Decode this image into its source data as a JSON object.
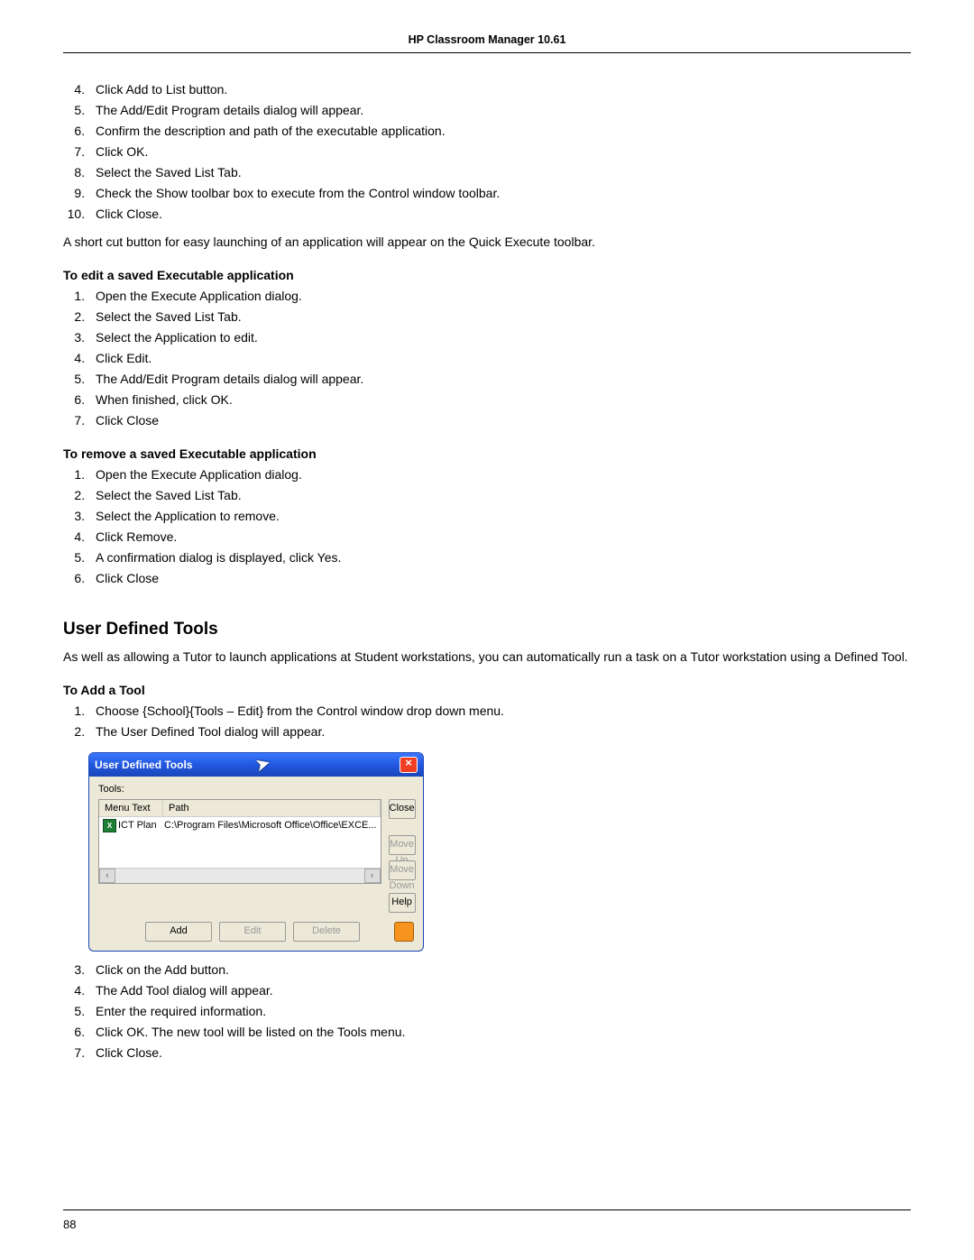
{
  "header": "HP Classroom Manager 10.61",
  "list1_start": 4,
  "list1": [
    "Click Add to List button.",
    "The Add/Edit Program details dialog will appear.",
    "Confirm the description and path of the executable application.",
    "Click OK.",
    "Select the Saved List Tab.",
    "Check the Show toolbar box to execute from the Control window toolbar.",
    "Click Close."
  ],
  "para_after_list1": "A short cut button for easy launching of an application will appear on the Quick Execute toolbar.",
  "heading_edit": "To edit a saved Executable application",
  "list_edit": [
    "Open the Execute Application dialog.",
    "Select the Saved List Tab.",
    "Select the Application to edit.",
    "Click Edit.",
    "The Add/Edit Program details dialog will appear.",
    "When finished, click OK.",
    "Click Close"
  ],
  "heading_remove": "To remove a saved Executable application",
  "list_remove": [
    "Open the Execute Application dialog.",
    "Select the Saved List Tab.",
    "Select the Application to remove.",
    "Click Remove.",
    "A confirmation dialog is displayed, click Yes.",
    "Click Close"
  ],
  "section_heading": "User Defined Tools",
  "section_para": "As well as allowing a Tutor to launch applications at Student workstations, you can automatically run a task on a Tutor workstation using a Defined Tool.",
  "heading_add": "To Add a Tool",
  "list_add_a": [
    "Choose {School}{Tools – Edit} from the Control window drop down menu.",
    "The User Defined Tool dialog will appear."
  ],
  "list_add_b_start": 3,
  "list_add_b": [
    "Click on the Add button.",
    "The Add Tool dialog will appear.",
    "Enter the required information.",
    "Click OK. The new tool will be listed on the Tools menu.",
    "Click Close."
  ],
  "dialog": {
    "title": "User Defined Tools",
    "tools_label": "Tools:",
    "col_menu": "Menu Text",
    "col_path": "Path",
    "row_icon_text": "X",
    "row_menu": "ICT Plan",
    "row_path": "C:\\Program Files\\Microsoft Office\\Office\\EXCE...",
    "btn_close": "Close",
    "btn_moveup": "Move Up",
    "btn_movedown": "Move Down",
    "btn_help": "Help",
    "btn_add": "Add",
    "btn_edit": "Edit",
    "btn_delete": "Delete",
    "close_x": "×"
  },
  "page_number": "88"
}
